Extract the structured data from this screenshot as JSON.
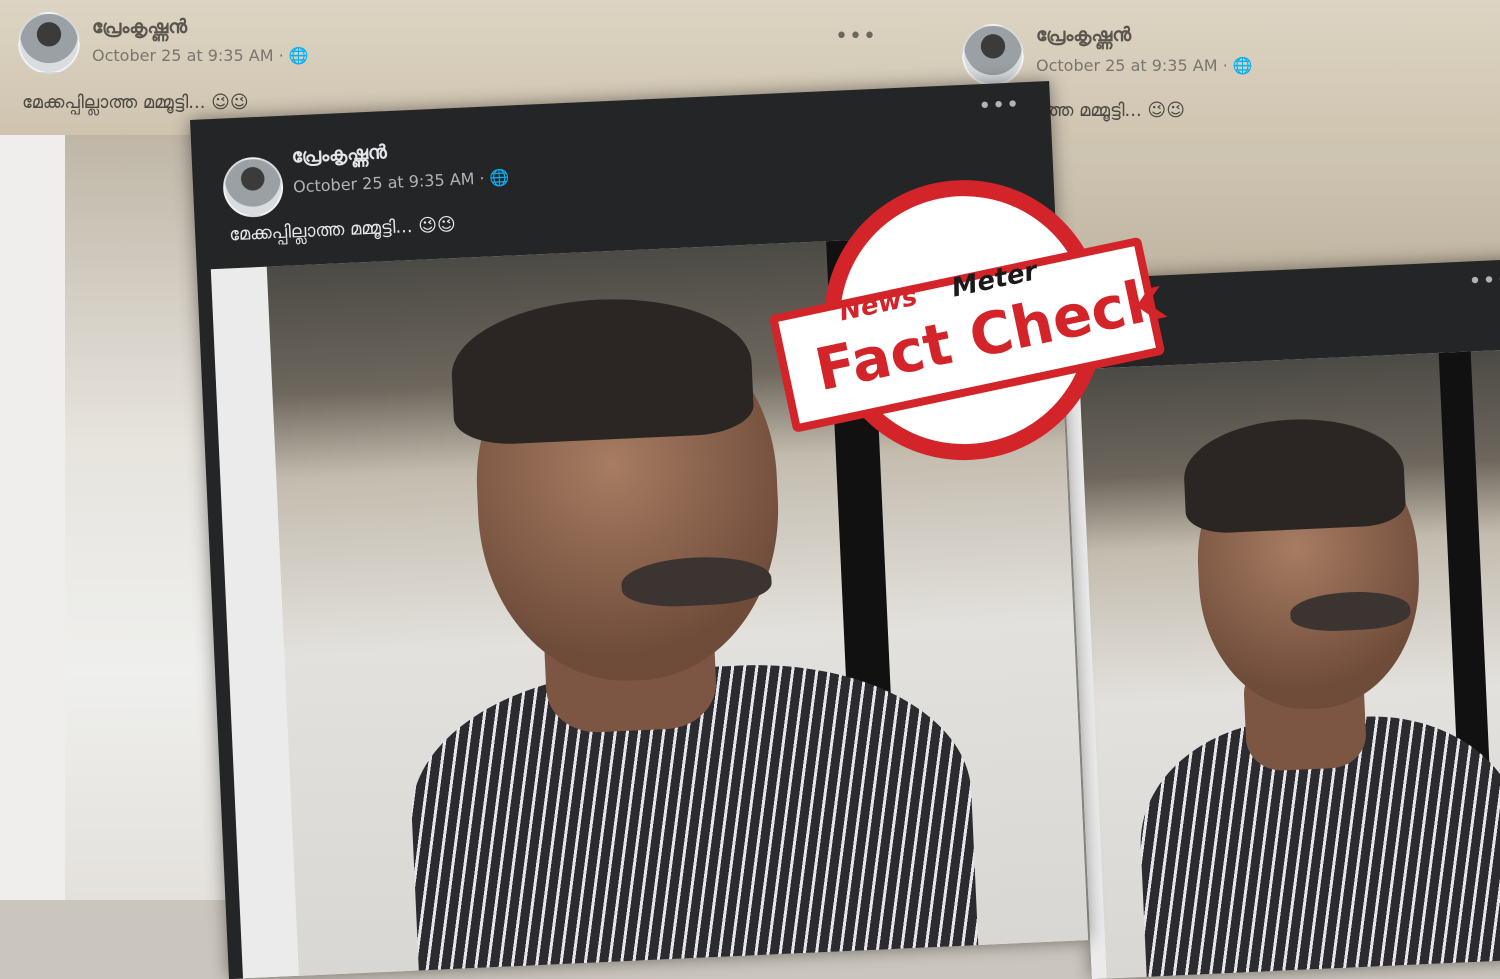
{
  "post": {
    "author": "പ്രേംകൃഷ്ണൻ",
    "timestamp": "October 25 at 9:35 AM · 🌐",
    "caption": "മേക്കപ്പില്ലാത്ത മമ്മൂട്ടി... 😉😉",
    "caption_partial": "ല്ലാത്ത മമ്മൂട്ടി... 😉😉",
    "more_icon": "•••"
  },
  "stamp": {
    "brand_news": "News",
    "brand_meter": "Meter",
    "label": "Fact Check",
    "color": "#d3242a"
  }
}
